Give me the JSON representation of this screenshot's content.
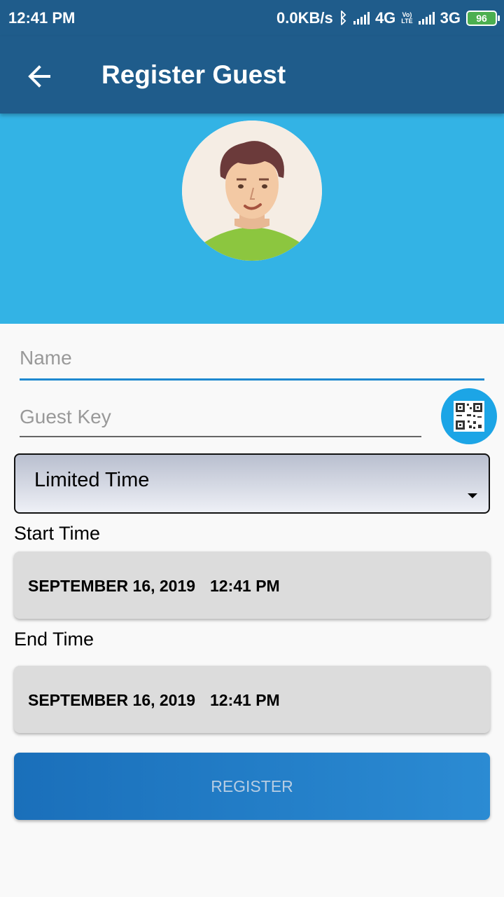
{
  "status_bar": {
    "time": "12:41 PM",
    "speed": "0.0KB/s",
    "net1": "4G",
    "volte_top": "Vo)",
    "volte_bottom": "LTE",
    "net2": "3G",
    "battery": "96",
    "battery_color": "#4caf50"
  },
  "app_bar": {
    "title": "Register Guest",
    "color": "#1f5c8b"
  },
  "header": {
    "color": "#33b3e5"
  },
  "form": {
    "name_placeholder": "Name",
    "guest_key_placeholder": "Guest Key",
    "access_type": "Limited Time",
    "start_label": "Start Time",
    "start_date": "SEPTEMBER 16, 2019",
    "start_time": "12:41 PM",
    "end_label": "End Time",
    "end_date": "SEPTEMBER 16, 2019",
    "end_time": "12:41 PM",
    "register_label": "REGISTER"
  }
}
